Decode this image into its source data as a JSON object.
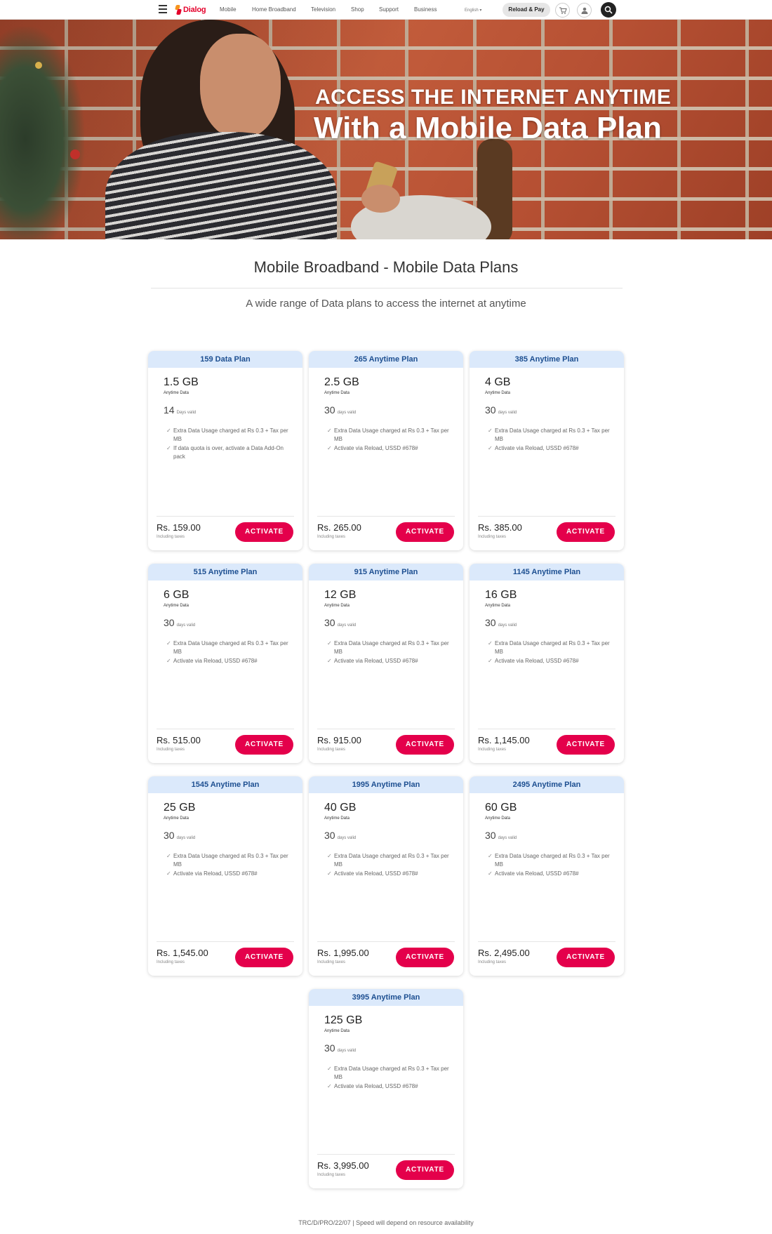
{
  "nav": {
    "logo": "Dialog",
    "links": [
      "Mobile",
      "Home Broadband",
      "Television",
      "Shop",
      "Support",
      "Business"
    ],
    "language": "English ▾",
    "reload_label": "Reload & Pay"
  },
  "hero": {
    "line1": "ACCESS THE INTERNET ANYTIME",
    "line2": "With a Mobile Data Plan"
  },
  "page": {
    "title": "Mobile Broadband - Mobile Data Plans",
    "subtitle": "A wide range of Data plans to access the internet at anytime"
  },
  "plans": [
    {
      "name": "159 Data Plan",
      "data": "1.5 GB",
      "data_label": "Anytime Data",
      "days": "14",
      "days_label": "Days valid",
      "features": [
        "Extra Data Usage charged at Rs 0.3 + Tax per MB",
        "If data quota is over, activate a Data Add-On pack"
      ],
      "price": "Rs. 159.00",
      "tax_note": "Including taxes",
      "cta": "ACTIVATE"
    },
    {
      "name": "265 Anytime Plan",
      "data": "2.5 GB",
      "data_label": "Anytime Data",
      "days": "30",
      "days_label": "days valid",
      "features": [
        "Extra Data Usage charged at Rs 0.3 + Tax per MB",
        "Activate via Reload, USSD #678#"
      ],
      "price": "Rs. 265.00",
      "tax_note": "Including taxes",
      "cta": "ACTIVATE"
    },
    {
      "name": "385 Anytime Plan",
      "data": "4 GB",
      "data_label": "Anytime Data",
      "days": "30",
      "days_label": "days valid",
      "features": [
        "Extra Data Usage charged at Rs 0.3 + Tax per MB",
        "Activate via Reload, USSD #678#"
      ],
      "price": "Rs. 385.00",
      "tax_note": "Including taxes",
      "cta": "ACTIVATE"
    },
    {
      "name": "515 Anytime Plan",
      "data": "6 GB",
      "data_label": "Anytime Data",
      "days": "30",
      "days_label": "days valid",
      "features": [
        "Extra Data Usage charged at Rs 0.3 + Tax per MB",
        "Activate via Reload, USSD #678#"
      ],
      "price": "Rs. 515.00",
      "tax_note": "Including taxes",
      "cta": "ACTIVATE"
    },
    {
      "name": "915 Anytime Plan",
      "data": "12 GB",
      "data_label": "Anytime Data",
      "days": "30",
      "days_label": "days valid",
      "features": [
        "Extra Data Usage charged at Rs 0.3 + Tax per MB",
        "Activate via Reload, USSD #678#"
      ],
      "price": "Rs. 915.00",
      "tax_note": "Including taxes",
      "cta": "ACTIVATE"
    },
    {
      "name": "1145 Anytime Plan",
      "data": "16 GB",
      "data_label": "Anytime Data",
      "days": "30",
      "days_label": "days valid",
      "features": [
        "Extra Data Usage charged at Rs 0.3 + Tax per MB",
        "Activate via Reload, USSD #678#"
      ],
      "price": "Rs. 1,145.00",
      "tax_note": "Including taxes",
      "cta": "ACTIVATE"
    },
    {
      "name": "1545 Anytime Plan",
      "data": "25 GB",
      "data_label": "Anytime Data",
      "days": "30",
      "days_label": "days valid",
      "features": [
        "Extra Data Usage charged at Rs 0.3 + Tax per MB",
        "Activate via Reload, USSD #678#"
      ],
      "price": "Rs. 1,545.00",
      "tax_note": "Including taxes",
      "cta": "ACTIVATE"
    },
    {
      "name": "1995 Anytime Plan",
      "data": "40 GB",
      "data_label": "Anytime Data",
      "days": "30",
      "days_label": "days valid",
      "features": [
        "Extra Data Usage charged at Rs 0.3 + Tax per MB",
        "Activate via Reload, USSD #678#"
      ],
      "price": "Rs. 1,995.00",
      "tax_note": "Including taxes",
      "cta": "ACTIVATE"
    },
    {
      "name": "2495 Anytime Plan",
      "data": "60 GB",
      "data_label": "Anytime Data",
      "days": "30",
      "days_label": "days valid",
      "features": [
        "Extra Data Usage charged at Rs 0.3 + Tax per MB",
        "Activate via Reload, USSD #678#"
      ],
      "price": "Rs. 2,495.00",
      "tax_note": "Including taxes",
      "cta": "ACTIVATE"
    },
    {
      "name": "3995 Anytime Plan",
      "data": "125 GB",
      "data_label": "Anytime Data",
      "days": "30",
      "days_label": "days valid",
      "features": [
        "Extra Data Usage charged at Rs 0.3 + Tax per MB",
        "Activate via Reload, USSD #678#"
      ],
      "price": "Rs. 3,995.00",
      "tax_note": "Including taxes",
      "cta": "ACTIVATE"
    }
  ],
  "footer": {
    "text": "TRC/D/PRO/22/07  |  Speed will depend on resource availability"
  },
  "colors": {
    "accent": "#e4004b",
    "brand": "#e4002b",
    "plan_header_bg": "#dbe9fb",
    "plan_header_text": "#1d4f91"
  }
}
